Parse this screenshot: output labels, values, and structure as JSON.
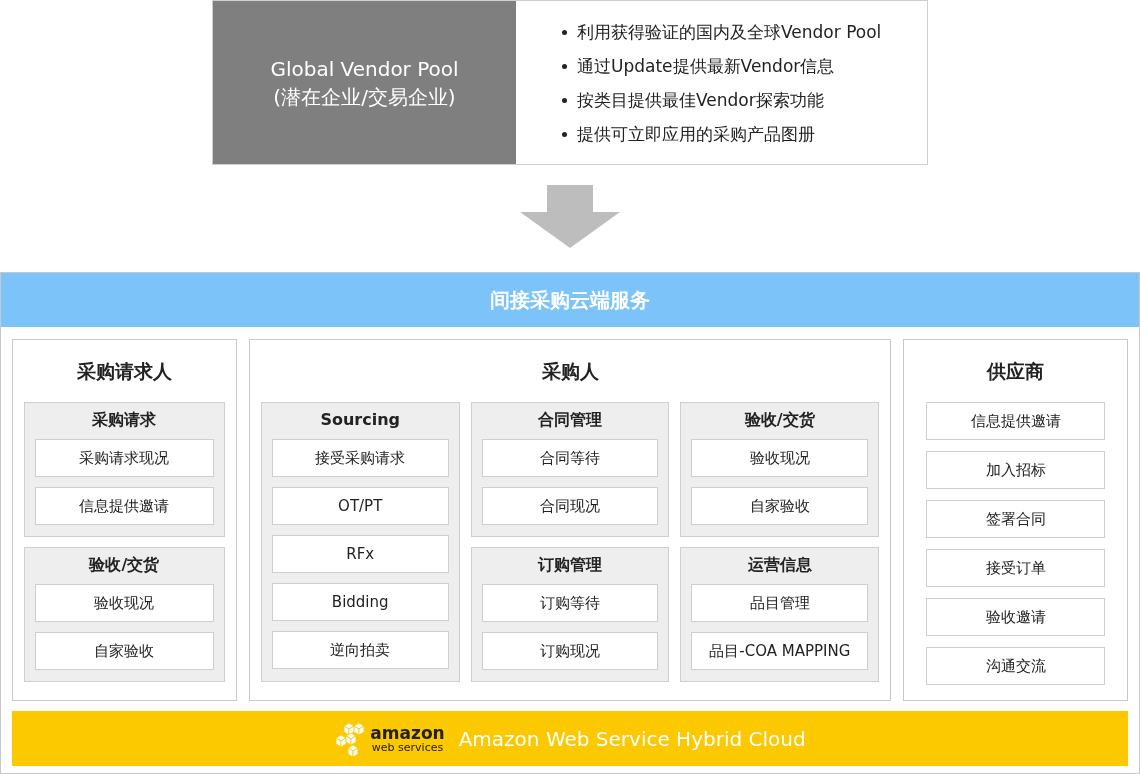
{
  "vendor_pool": {
    "title_lines": [
      "Global Vendor Pool",
      "(潜在企业/交易企业)"
    ],
    "bullets": [
      "利用获得验证的国内及全球Vendor Pool",
      "通过Update提供最新Vendor信息",
      "按类目提供最佳Vendor探索功能",
      "提供可立即应用的采购产品图册"
    ]
  },
  "service": {
    "title": "间接采购云端服务",
    "panels": [
      {
        "kind": "grouped",
        "title": "采购请求人",
        "columns": [
          [
            {
              "title": "采购请求",
              "items": [
                "采购请求现况",
                "信息提供邀请"
              ]
            },
            {
              "title": "验收/交货",
              "items": [
                "验收现况",
                "自家验收"
              ]
            }
          ]
        ]
      },
      {
        "kind": "grouped",
        "title": "采购人",
        "columns": [
          [
            {
              "title": "Sourcing",
              "items": [
                "接受采购请求",
                "OT/PT",
                "RFx",
                "Bidding",
                "逆向拍卖"
              ]
            }
          ],
          [
            {
              "title": "合同管理",
              "items": [
                "合同等待",
                "合同现况"
              ]
            },
            {
              "title": "订购管理",
              "items": [
                "订购等待",
                "订购现况"
              ]
            }
          ],
          [
            {
              "title": "验收/交货",
              "items": [
                "验收现况",
                "自家验收"
              ]
            },
            {
              "title": "运营信息",
              "items": [
                "品目管理",
                "品目-COA MAPPING"
              ]
            }
          ]
        ]
      },
      {
        "kind": "list",
        "title": "供应商",
        "items": [
          "信息提供邀请",
          "加入招标",
          "签署合同",
          "接受订单",
          "验收邀请",
          "沟通交流"
        ]
      }
    ]
  },
  "cloud_bar": {
    "logo_word": "amazon",
    "logo_sub": "web services",
    "label": "Amazon Web Service Hybrid Cloud"
  }
}
